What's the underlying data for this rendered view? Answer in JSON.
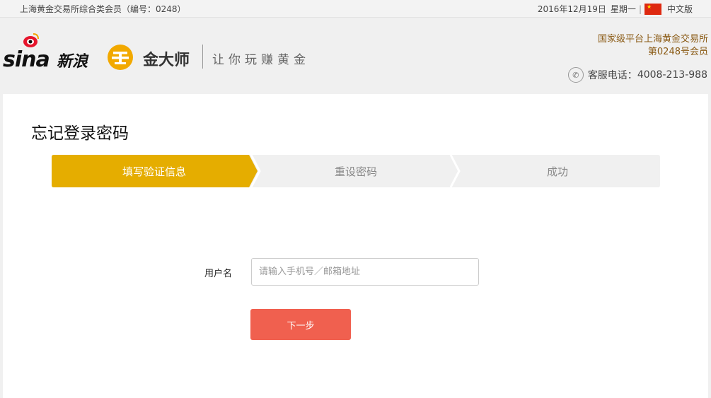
{
  "topbar": {
    "member_text": "上海黄金交易所综合类会员（编号：0248）",
    "date": "2016年12月19日",
    "weekday": "星期一",
    "language": "中文版"
  },
  "header": {
    "sina_logo": "sina",
    "sina_cn": "新浪",
    "jds_name": "金大师",
    "slogan": "让你玩赚黄金",
    "org_line1": "国家级平台上海黄金交易所",
    "org_line2": "第0248号会员",
    "phone_label": "客服电话：",
    "phone_number": "4008-213-988"
  },
  "page": {
    "title": "忘记登录密码"
  },
  "steps": [
    {
      "label": "填写验证信息",
      "active": true
    },
    {
      "label": "重设密码",
      "active": false
    },
    {
      "label": "成功",
      "active": false
    }
  ],
  "form": {
    "username_label": "用户名",
    "username_placeholder": "请输入手机号／邮箱地址",
    "username_value": "",
    "next_button": "下一步"
  },
  "colors": {
    "step_active": "#e5ad00",
    "step_inactive": "#f0f0f0",
    "button": "#f0604f",
    "accent_text": "#8a5a14"
  }
}
